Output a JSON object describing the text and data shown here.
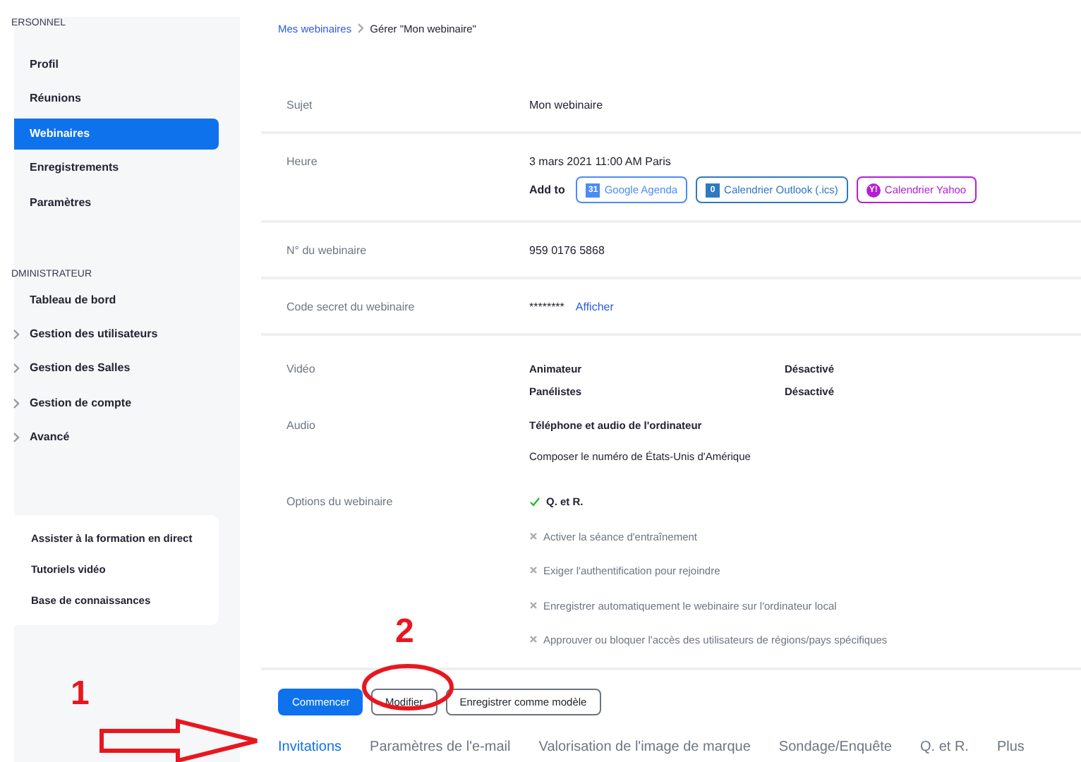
{
  "sidebar": {
    "sections": [
      {
        "title": "ERSONNEL",
        "items": [
          {
            "label": "Profil",
            "selected": false,
            "expandable": false
          },
          {
            "label": "Réunions",
            "selected": false,
            "expandable": false
          },
          {
            "label": "Webinaires",
            "selected": true,
            "expandable": false
          },
          {
            "label": "Enregistrements",
            "selected": false,
            "expandable": false
          },
          {
            "label": "Paramètres",
            "selected": false,
            "expandable": false
          }
        ]
      },
      {
        "title": "DMINISTRATEUR",
        "items": [
          {
            "label": "Tableau de bord",
            "selected": false,
            "expandable": false
          },
          {
            "label": "Gestion des utilisateurs",
            "selected": false,
            "expandable": true
          },
          {
            "label": "Gestion des Salles",
            "selected": false,
            "expandable": true
          },
          {
            "label": "Gestion de compte",
            "selected": false,
            "expandable": true
          },
          {
            "label": "Avancé",
            "selected": false,
            "expandable": true
          }
        ]
      }
    ],
    "help_links": [
      "Assister à la formation en direct",
      "Tutoriels vidéo",
      "Base de connaissances"
    ]
  },
  "breadcrumb": [
    {
      "label": "Mes webinaires",
      "link": true
    },
    {
      "label": "Gérer \"Mon webinaire\"",
      "link": false
    }
  ],
  "details": [
    [
      {
        "kind": "text",
        "label": "Sujet",
        "value": "Mon webinaire"
      }
    ],
    [
      {
        "kind": "time",
        "label": "Heure",
        "value": "3 mars 2021 11:00 AM Paris",
        "add_to": "Add to",
        "calendars": [
          {
            "label": "Google Agenda",
            "color": "#4a8cf7",
            "icon": "31"
          },
          {
            "label": "Calendrier Outlook (.ics)",
            "color": "#2f79c0",
            "icon": "0"
          },
          {
            "label": "Calendrier Yahoo",
            "color": "#b41fd6",
            "icon": "Y!"
          }
        ]
      }
    ],
    [
      {
        "kind": "text",
        "label": "N° du webinaire",
        "value": "959 0176 5868"
      }
    ],
    [
      {
        "kind": "secret",
        "label": "Code secret du webinaire",
        "value": "********",
        "link": "Afficher"
      }
    ],
    [
      {
        "kind": "pairs",
        "label": "Vidéo",
        "pairs": [
          {
            "name": "Animateur",
            "value": "Désactivé"
          },
          {
            "name": "Panélistes",
            "value": "Désactivé"
          }
        ]
      },
      {
        "kind": "lines",
        "label": "Audio",
        "lines": [
          {
            "text": "Téléphone et audio de l'ordinateur",
            "bold": true
          },
          {
            "text": "Composer le numéro de États-Unis d'Amérique",
            "bold": false
          }
        ]
      },
      {
        "kind": "options",
        "label": "Options du webinaire",
        "options": [
          {
            "label": "Q. et R.",
            "enabled": true
          },
          {
            "label": "Activer la séance d'entraînement",
            "enabled": false
          },
          {
            "label": "Exiger l'authentification pour rejoindre",
            "enabled": false
          },
          {
            "label": "Enregistrer automatiquement le webinaire sur l'ordinateur local",
            "enabled": false
          },
          {
            "label": "Approuver ou bloquer l'accès des utilisateurs de régions/pays spécifiques",
            "enabled": false
          }
        ]
      }
    ]
  ],
  "actions": [
    {
      "label": "Commencer",
      "kind": "primary"
    },
    {
      "label": "Modifier",
      "kind": "outline"
    },
    {
      "label": "Enregistrer comme modèle",
      "kind": "outline"
    }
  ],
  "tabs": [
    {
      "label": "Invitations",
      "selected": true
    },
    {
      "label": "Paramètres de l'e-mail",
      "selected": false
    },
    {
      "label": "Valorisation de l'image de marque",
      "selected": false
    },
    {
      "label": "Sondage/Enquête",
      "selected": false
    },
    {
      "label": "Q. et R.",
      "selected": false
    },
    {
      "label": "Plus",
      "selected": false
    }
  ],
  "annotations": [
    {
      "text": "1"
    },
    {
      "text": "2"
    }
  ]
}
